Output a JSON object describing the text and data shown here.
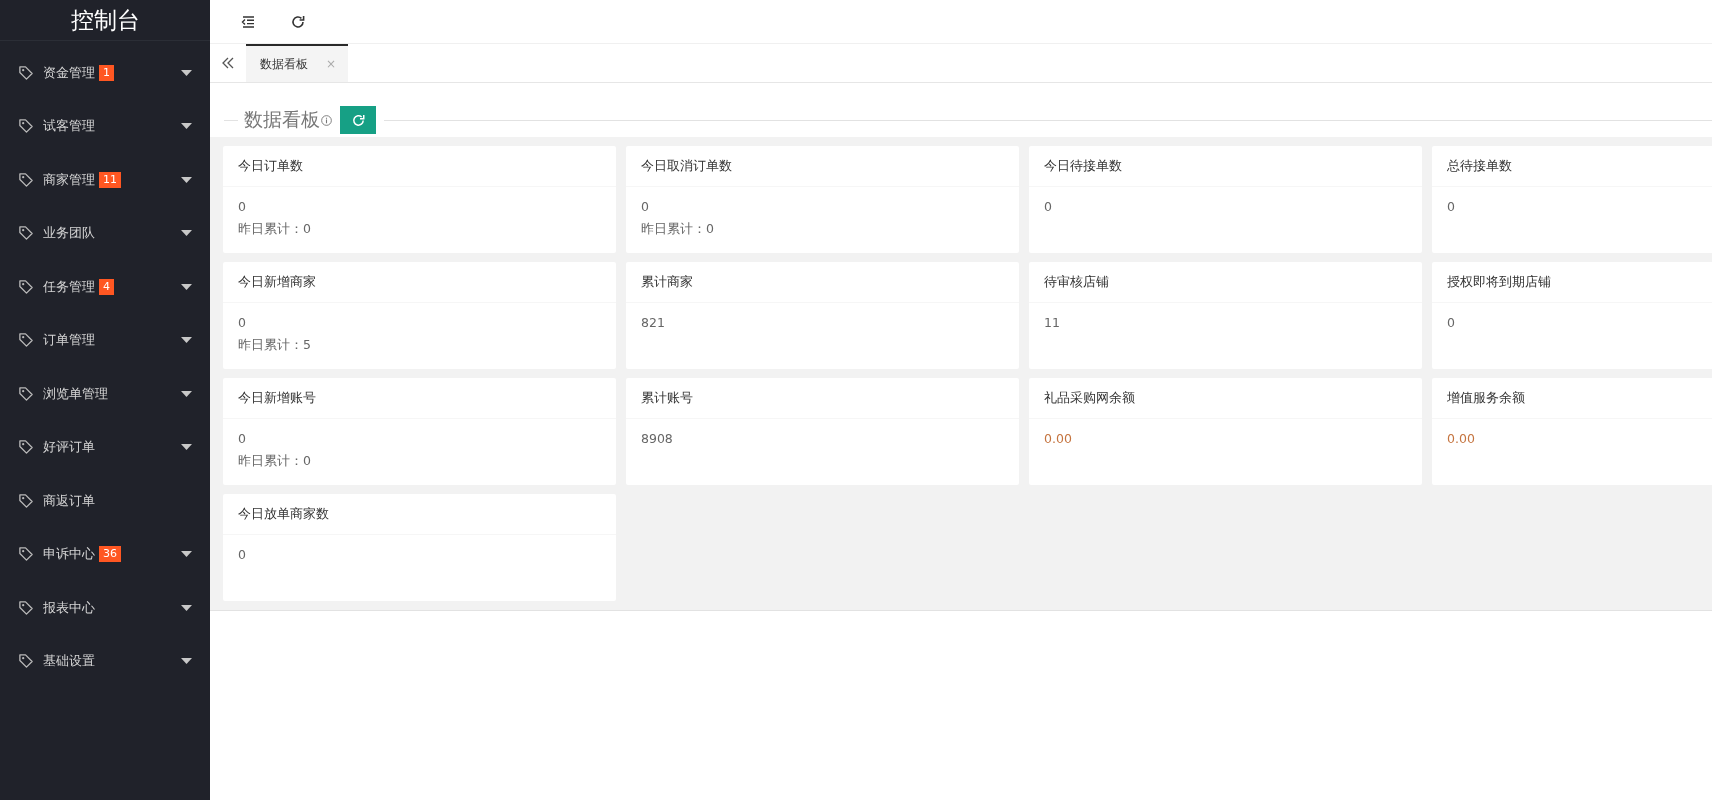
{
  "sidebar": {
    "title": "控制台",
    "items": [
      {
        "label": "资金管理",
        "badge": "1",
        "has_submenu": true
      },
      {
        "label": "试客管理",
        "has_submenu": true
      },
      {
        "label": "商家管理",
        "badge": "11",
        "has_submenu": true
      },
      {
        "label": "业务团队",
        "has_submenu": true
      },
      {
        "label": "任务管理",
        "badge": "4",
        "has_submenu": true
      },
      {
        "label": "订单管理",
        "has_submenu": true
      },
      {
        "label": "浏览单管理",
        "has_submenu": true
      },
      {
        "label": "好评订单",
        "has_submenu": true
      },
      {
        "label": "商返订单",
        "has_submenu": false
      },
      {
        "label": "申诉中心",
        "badge": "36",
        "has_submenu": true
      },
      {
        "label": "报表中心",
        "has_submenu": true
      },
      {
        "label": "基础设置",
        "has_submenu": true
      }
    ]
  },
  "tabs": [
    {
      "label": "数据看板",
      "selected": true,
      "close": "×"
    }
  ],
  "section": {
    "title": "数据看板"
  },
  "cards": [
    {
      "title": "今日订单数",
      "value": "0",
      "note": "昨日累计：0",
      "highlighted": false
    },
    {
      "title": "今日取消订单数",
      "value": "0",
      "note": "昨日累计：0",
      "highlighted": false
    },
    {
      "title": "今日待接单数",
      "value": "0",
      "highlighted": false
    },
    {
      "title": "总待接单数",
      "value": "0",
      "highlighted": false
    },
    {
      "title": "今日新增商家",
      "value": "0",
      "note": "昨日累计：5",
      "highlighted": false
    },
    {
      "title": "累计商家",
      "value": "821",
      "highlighted": false
    },
    {
      "title": "待审核店铺",
      "value": "11",
      "highlighted": false
    },
    {
      "title": "授权即将到期店铺",
      "value": "0",
      "highlighted": false
    },
    {
      "title": "今日新增账号",
      "value": "0",
      "note": "昨日累计：0",
      "highlighted": false
    },
    {
      "title": "累计账号",
      "value": "8908",
      "highlighted": false
    },
    {
      "title": "礼品采购网余额",
      "value": "0.00",
      "highlighted": true
    },
    {
      "title": "增值服务余额",
      "value": "0.00",
      "highlighted": true
    },
    {
      "title": "今日放单商家数",
      "value": "0",
      "highlighted": false
    }
  ]
}
